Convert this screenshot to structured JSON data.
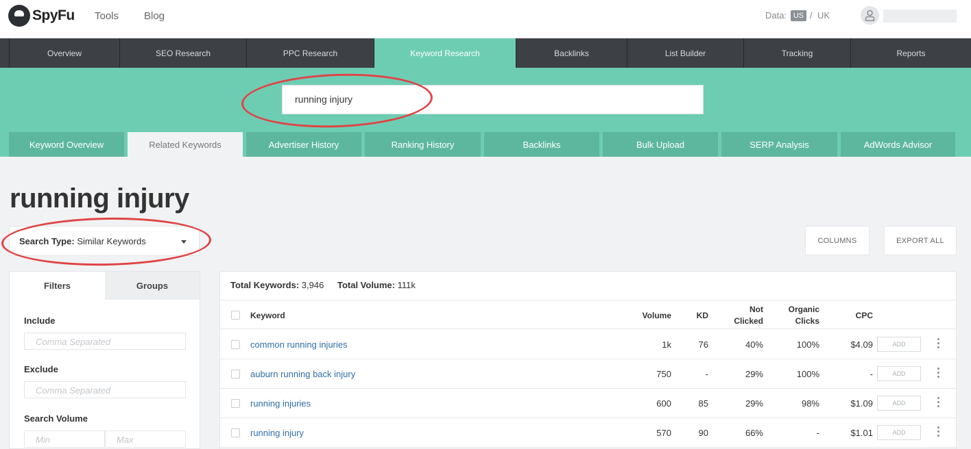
{
  "header": {
    "logo_text": "SpyFu",
    "nav_links": [
      "Tools",
      "Blog"
    ],
    "data_label": "Data:",
    "data_us": "US",
    "data_sep": "/",
    "data_uk": "UK"
  },
  "main_nav": [
    "Overview",
    "SEO Research",
    "PPC Research",
    "Keyword Research",
    "Backlinks",
    "List Builder",
    "Tracking",
    "Reports"
  ],
  "search": {
    "value": "running injury"
  },
  "sub_tabs": [
    "Keyword Overview",
    "Related Keywords",
    "Advertiser History",
    "Ranking History",
    "Backlinks",
    "Bulk Upload",
    "SERP Analysis",
    "AdWords Advisor"
  ],
  "page_title": "running injury",
  "search_type": {
    "label": "Search Type:",
    "value": "Similar Keywords"
  },
  "buttons": {
    "columns": "COLUMNS",
    "export_all": "EXPORT ALL"
  },
  "filters": {
    "tabs": [
      "Filters",
      "Groups"
    ],
    "include_label": "Include",
    "include_placeholder": "Comma Separated",
    "exclude_label": "Exclude",
    "exclude_placeholder": "Comma Separated",
    "volume_label": "Search Volume",
    "min_placeholder": "Min",
    "max_placeholder": "Max"
  },
  "totals": {
    "keywords_label": "Total Keywords:",
    "keywords_value": "3,946",
    "volume_label": "Total Volume:",
    "volume_value": "111k"
  },
  "table": {
    "headers": {
      "keyword": "Keyword",
      "volume": "Volume",
      "kd": "KD",
      "not_clicked_1": "Not",
      "not_clicked_2": "Clicked",
      "organic_1": "Organic",
      "organic_2": "Clicks",
      "cpc": "CPC"
    },
    "add_label": "ADD",
    "rows": [
      {
        "keyword": "common running injuries",
        "volume": "1k",
        "kd": "76",
        "not_clicked": "40%",
        "organic": "100%",
        "cpc": "$4.09"
      },
      {
        "keyword": "auburn running back injury",
        "volume": "750",
        "kd": "-",
        "not_clicked": "29%",
        "organic": "100%",
        "cpc": "-"
      },
      {
        "keyword": "running injuries",
        "volume": "600",
        "kd": "85",
        "not_clicked": "29%",
        "organic": "98%",
        "cpc": "$1.09"
      },
      {
        "keyword": "running injury",
        "volume": "570",
        "kd": "90",
        "not_clicked": "66%",
        "organic": "-",
        "cpc": "$1.01"
      }
    ]
  },
  "colors": {
    "teal": "#6dcdb3",
    "nav_dark": "#3d4045",
    "link": "#2f6ea8",
    "annotation": "#e04444"
  }
}
